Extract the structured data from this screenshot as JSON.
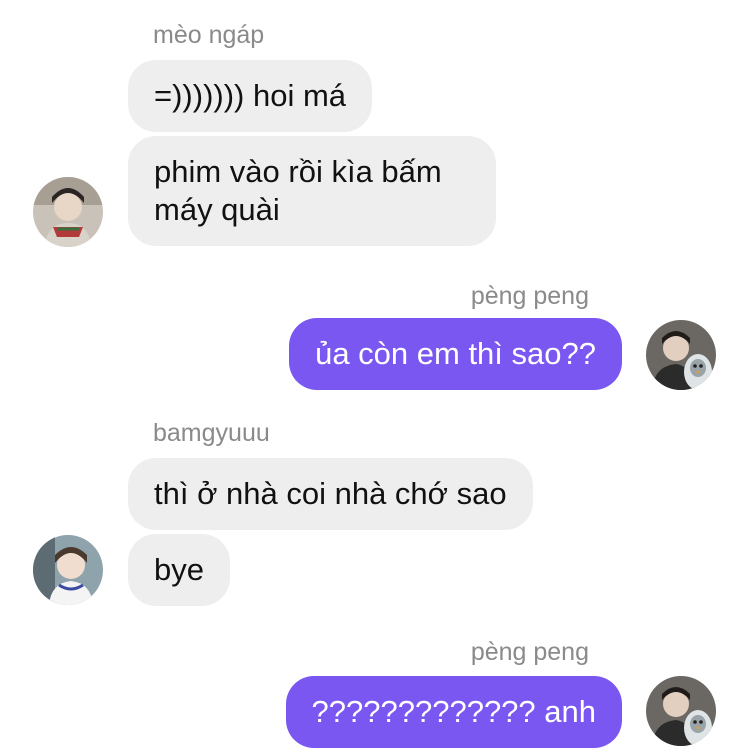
{
  "messages": [
    {
      "sender": "mèo ngáp",
      "bubbles": [
        "=))))))) hoi má",
        "phim vào rồi kìa bấm\nmáy quài"
      ]
    },
    {
      "sender": "pèng peng",
      "bubbles": [
        "ủa còn em thì sao??"
      ]
    },
    {
      "sender": "bamgyuuu",
      "bubbles": [
        "thì ở nhà coi nhà chớ sao",
        "bye"
      ]
    },
    {
      "sender": "pèng peng",
      "bubbles": [
        "????????????? anh"
      ]
    }
  ],
  "colors": {
    "incoming_bubble": "#eeeeee",
    "outgoing_bubble": "#7b57f2",
    "sender_name": "#8a8a8a"
  }
}
